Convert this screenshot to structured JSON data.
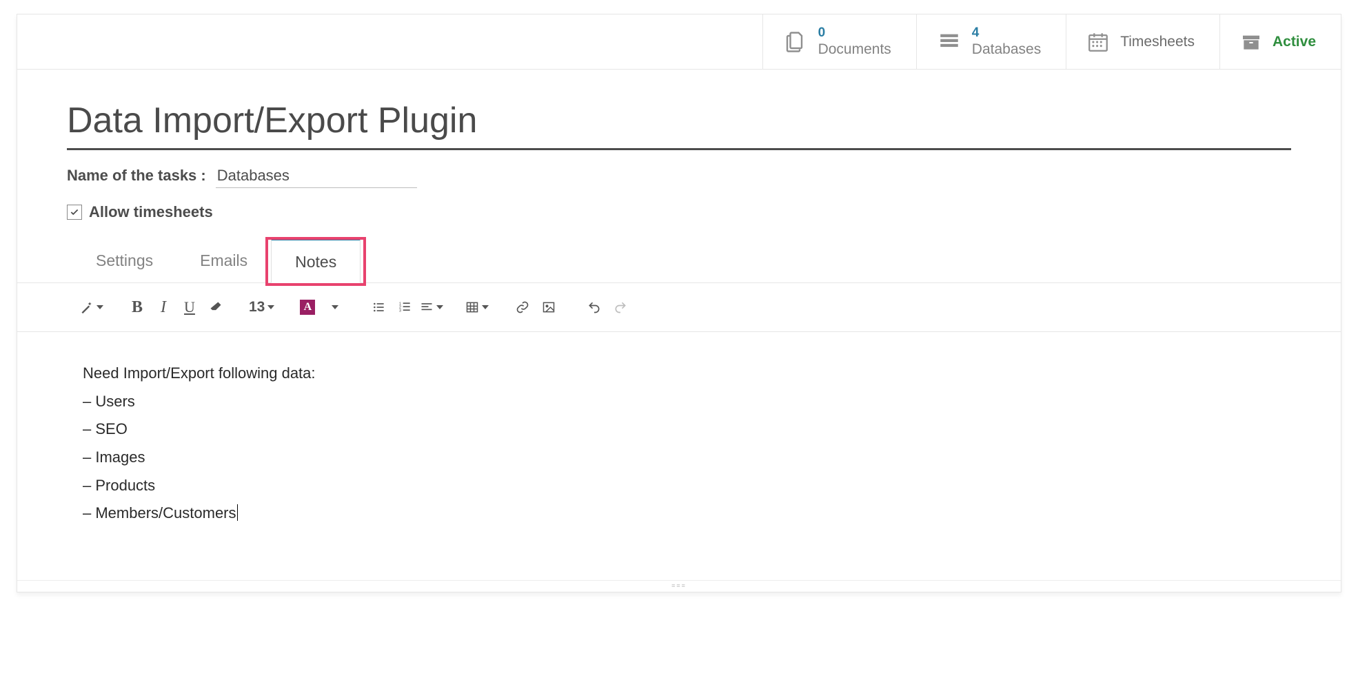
{
  "topbar": {
    "documents": {
      "count": "0",
      "label": "Documents"
    },
    "databases": {
      "count": "4",
      "label": "Databases"
    },
    "timesheets": {
      "label": "Timesheets"
    },
    "status": {
      "label": "Active"
    }
  },
  "title": "Data Import/Export Plugin",
  "task_field": {
    "label": "Name of the tasks :",
    "value": "Databases"
  },
  "allow_timesheets": {
    "label": "Allow timesheets",
    "checked": true
  },
  "tabs": {
    "items": [
      {
        "label": "Settings",
        "active": false
      },
      {
        "label": "Emails",
        "active": false
      },
      {
        "label": "Notes",
        "active": true
      }
    ]
  },
  "toolbar": {
    "font_size": "13",
    "font_color_glyph": "A"
  },
  "notes": {
    "heading": "Need Import/Export following data:",
    "lines": [
      "– Users",
      "– SEO",
      "– Images",
      "– Products",
      "– Members/Customers"
    ]
  }
}
